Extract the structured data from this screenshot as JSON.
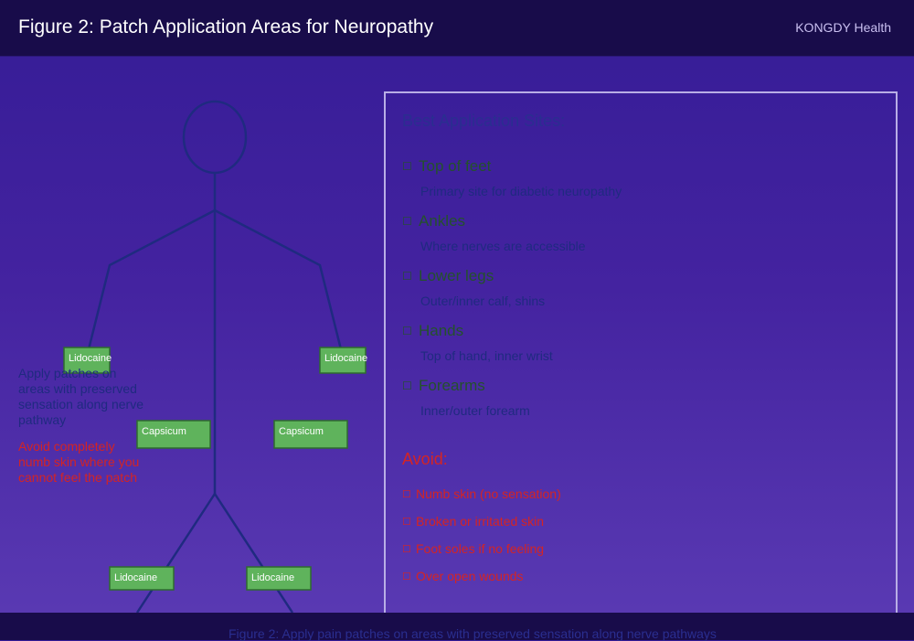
{
  "header": {
    "title": "Figure 2: Patch Application Areas for Neuropathy",
    "brand": "KONGDY Health"
  },
  "figure": {
    "patches": [
      {
        "label": "Lidocaine",
        "location": "left-hand"
      },
      {
        "label": "Lidocaine",
        "location": "right-hand"
      },
      {
        "label": "Capsicum",
        "location": "left-side"
      },
      {
        "label": "Capsicum",
        "location": "right-side"
      },
      {
        "label": "Lidocaine",
        "location": "left-lower-leg"
      },
      {
        "label": "Lidocaine",
        "location": "right-lower-leg"
      }
    ],
    "note_apply": "Apply patches on areas with preserved sensation along nerve pathway",
    "note_avoid": "Avoid completely numb skin where you cannot feel the patch"
  },
  "panel": {
    "title": "Best Application Sites:",
    "sites": [
      {
        "icon": "checkbox-icon",
        "name": "Top of feet",
        "desc": "Primary site for diabetic neuropathy"
      },
      {
        "icon": "checkbox-icon",
        "name": "Ankles",
        "desc": "Where nerves are accessible"
      },
      {
        "icon": "checkbox-icon",
        "name": "Lower legs",
        "desc": "Outer/inner calf, shins"
      },
      {
        "icon": "checkbox-icon",
        "name": "Hands",
        "desc": "Top of hand, inner wrist"
      },
      {
        "icon": "checkbox-icon",
        "name": "Forearms",
        "desc": "Inner/outer forearm"
      }
    ],
    "avoid_title": "Avoid:",
    "avoid": [
      {
        "icon": "checkbox-icon",
        "text": "Numb skin (no sensation)"
      },
      {
        "icon": "checkbox-icon",
        "text": "Broken or irritated skin"
      },
      {
        "icon": "checkbox-icon",
        "text": "Foot soles if no feeling"
      },
      {
        "icon": "checkbox-icon",
        "text": "Over open wounds"
      }
    ]
  },
  "footer": {
    "caption": "Figure 2: Apply pain patches on areas with preserved sensation along nerve pathways"
  },
  "colors": {
    "header_bg": "#180c4a",
    "figure_line": "#1f2a80",
    "patch_fill": "#5fb35c",
    "patch_border": "#2e6b2e",
    "site_name": "#24512c",
    "warning": "#d42424"
  }
}
